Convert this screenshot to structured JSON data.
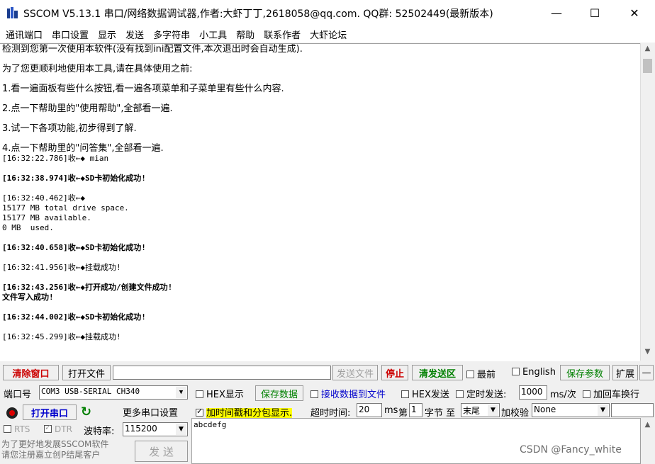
{
  "title_bar": {
    "title": "SSCOM V5.13.1 串口/网络数据调试器,作者:大虾丁丁,2618058@qq.com. QQ群: 52502449(最新版本)",
    "minimize": "—",
    "maximize": "☐",
    "close": "✕"
  },
  "menu": [
    "通讯端口",
    "串口设置",
    "显示",
    "发送",
    "多字符串",
    "小工具",
    "帮助",
    "联系作者",
    "大虾论坛"
  ],
  "receive": {
    "intro": [
      "检测到您第一次使用本软件(没有找到ini配置文件,本次退出时会自动生成).",
      "为了您更顺利地使用本工具,请在具体使用之前:",
      "1.看一遍面板有些什么按钮,看一遍各项菜单和子菜单里有些什么内容.",
      "2.点一下帮助里的\"使用帮助\",全部看一遍.",
      "3.试一下各项功能,初步得到了解.",
      "4.点一下帮助里的\"问答集\",全部看一遍."
    ],
    "log": [
      "[16:32:22.786]收←◆ mian",
      "[16:32:38.974]收←◆SD卡初始化成功!",
      "[16:32:40.462]收←◆",
      "15177 MB total drive space.",
      "15177 MB available.",
      "0 MB  used.",
      "[16:32:40.658]收←◆SD卡初始化成功!",
      "[16:32:41.956]收←◆挂载成功!",
      "[16:32:43.256]收←◆打开成功/创建文件成功!",
      "文件写入成功!",
      "[16:32:44.002]收←◆SD卡初始化成功!",
      "[16:32:45.299]收←◆挂载成功!"
    ]
  },
  "toolbar": {
    "clear": "清除窗口",
    "open_file": "打开文件",
    "send_file": "发送文件",
    "stop": "停止",
    "clear_send": "清发送区",
    "topmost": "最前",
    "english": "English",
    "save_params": "保存参数",
    "expand": "扩展",
    "collapse": "—"
  },
  "port": {
    "label": "端口号",
    "value": "COM3 USB-SERIAL CH340",
    "open_btn": "打开串口",
    "more_settings": "更多串口设置",
    "rts": "RTS",
    "dtr": "DTR",
    "baud_label": "波特率:",
    "baud": "115200"
  },
  "options": {
    "hex_display": "HEX显示",
    "save_data": "保存数据",
    "recv_to_file": "接收数据到文件",
    "hex_send": "HEX发送",
    "timed_send": "定时发送:",
    "interval": "1000",
    "interval_unit": "ms/次",
    "add_crlf": "加回车换行",
    "timestamp": "加时间戳和分包显示.",
    "timeout_label": "超时时间:",
    "timeout": "20",
    "timeout_unit": "ms",
    "byte_label": "第",
    "byte_index": "1",
    "byte_unit": "字节 至",
    "end": "末尾",
    "checksum": "加校验",
    "checksum_value": "None"
  },
  "send": {
    "text": "abcdefg",
    "button": "发 送"
  },
  "promo": [
    "为了更好地发展SSCOM软件",
    "请您注册嘉立创P结尾客户"
  ],
  "watermark": "CSDN @Fancy_white"
}
